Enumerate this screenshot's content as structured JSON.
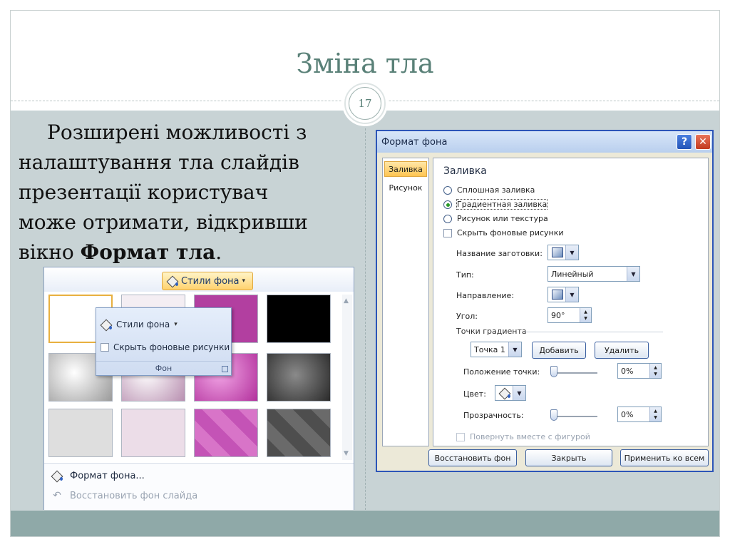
{
  "slide": {
    "title": "Зміна тла",
    "page_number": "17",
    "body_text_line1": "Розширені можливості з",
    "body_text_line2": "налаштування тла слайдів",
    "body_text_line3": "презентації користувач",
    "body_text_line4": "може отримати, відкривши",
    "body_text_prefix": "вікно ",
    "body_text_bold": "Формат тла",
    "body_text_suffix": "."
  },
  "gallery": {
    "styles_button_label": "Стили фона",
    "popup": {
      "styles_label": "Стили фона",
      "hide_bg_label": "Скрыть фоновые рисунки",
      "group_label": "Фон"
    },
    "menu": {
      "format_bg_label": "Формат фона...",
      "reset_bg_label": "Восстановить фон слайда"
    },
    "swatch_colors": [
      "#ffffff",
      "#f4eef3",
      "#b23fa0",
      "#000000",
      "#c8c8c8",
      "#e9d6e4",
      "#c24ab2",
      "#585858",
      "#dedede",
      "#ecdde8",
      "#c453b6",
      "#4e4e4e"
    ]
  },
  "dialog": {
    "title": "Формат фона",
    "help_glyph": "?",
    "close_glyph": "✕",
    "nav": [
      "Заливка",
      "Рисунок"
    ],
    "section_title": "Заливка",
    "fill_options": [
      "Сплошная заливка",
      "Градиентная заливка",
      "Рисунок или текстура"
    ],
    "selected_fill": "Градиентная заливка",
    "hide_bg_checkbox": "Скрыть фоновые рисунки",
    "preset_label": "Название заготовки:",
    "type_label": "Тип:",
    "type_value": "Линейный",
    "direction_label": "Направление:",
    "angle_label": "Угол:",
    "angle_value": "90°",
    "stops_group_label": "Точки градиента",
    "stop_select_value": "Точка 1",
    "add_button": "Добавить",
    "delete_button": "Удалить",
    "stop_position_label": "Положение точки:",
    "stop_position_value": "0%",
    "color_label": "Цвет:",
    "transparency_label": "Прозрачность:",
    "transparency_value": "0%",
    "rotate_with_shape_label": "Повернуть вместе с фигурой",
    "reset_button": "Восстановить фон",
    "close_button": "Закрыть",
    "apply_all_button": "Применить ко всем"
  },
  "colors": {
    "title_color": "#5a8178",
    "content_bg": "#c8d3d5",
    "bottom_band": "#8fa9a8",
    "dialog_title_bar": "#c7d9f1",
    "selected_nav": "#ffc552"
  }
}
